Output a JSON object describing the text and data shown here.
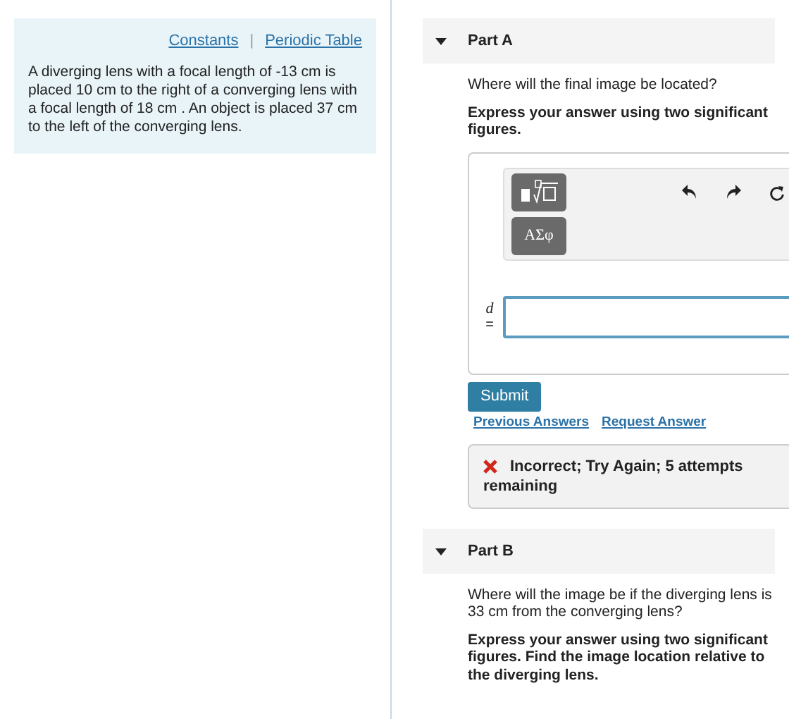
{
  "problem": {
    "links": [
      "Constants",
      "Periodic Table"
    ],
    "separator": "|",
    "text": "A diverging lens with a focal length of -13 cm is placed 10 cm to the right of a converging lens with a focal length of 18 cm . An object is placed 37 cm to the left of the converging lens."
  },
  "parts": [
    {
      "label": "Part A",
      "expanded": true,
      "question": "Where will the final image be located?",
      "instruction": "Express your answer using two significant figures.",
      "toolbar": {
        "symbols_button": "ΑΣφ"
      },
      "answer": {
        "variable": "d",
        "equals": "="
      },
      "submit": "Submit",
      "links": [
        "Previous Answers",
        "Request Answer"
      ],
      "feedback": {
        "kind": "incorrect",
        "text": "Incorrect; Try Again; 5 attempts remaining"
      }
    },
    {
      "label": "Part B",
      "expanded": true,
      "question": "Where will the image be if the diverging lens is 33 cm from the converging lens?",
      "instruction": "Express your answer using two significant figures. Find the image location relative to the diverging lens."
    }
  ]
}
